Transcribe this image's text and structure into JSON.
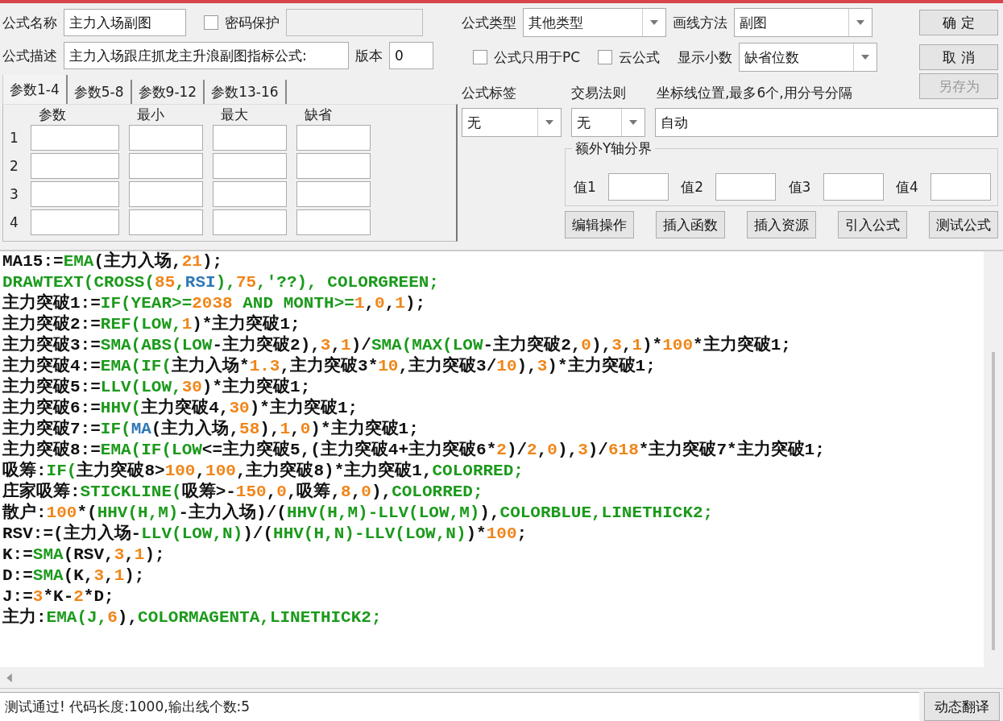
{
  "name": {
    "label": "公式名称",
    "value": "主力入场副图"
  },
  "password": {
    "label": "密码保护",
    "checked": false
  },
  "description": {
    "label": "公式描述",
    "value": "主力入场跟庄抓龙主升浪副图指标公式:"
  },
  "version": {
    "label": "版本",
    "value": "0"
  },
  "param_tabs": [
    {
      "label": "参数1-4",
      "selected": true
    },
    {
      "label": "参数5-8",
      "selected": false
    },
    {
      "label": "参数9-12",
      "selected": false
    },
    {
      "label": "参数13-16",
      "selected": false
    }
  ],
  "param_table": {
    "columns": [
      "参数",
      "最小",
      "最大",
      "缺省"
    ],
    "rows": [
      "1",
      "2",
      "3",
      "4"
    ]
  },
  "formula_type": {
    "label": "公式类型",
    "value": "其他类型"
  },
  "draw_method": {
    "label": "画线方法",
    "value": "副图"
  },
  "pc_only": {
    "label": "公式只用于PC",
    "checked": false
  },
  "cloud": {
    "label": "云公式",
    "checked": false
  },
  "decimals": {
    "label": "显示小数",
    "value": "缺省位数"
  },
  "side_buttons": [
    {
      "label": "确 定",
      "disabled": false
    },
    {
      "label": "取 消",
      "disabled": false
    },
    {
      "label": "另存为",
      "disabled": true
    }
  ],
  "formula_tag": {
    "label": "公式标签",
    "value": "无"
  },
  "trade_rule": {
    "label": "交易法则",
    "value": "无"
  },
  "axis_lines": {
    "label": "坐标线位置,最多6个,用分号分隔",
    "value": "自动"
  },
  "y_bounds": {
    "title": "额外Y轴分界",
    "labels": [
      "值1",
      "值2",
      "值3",
      "值4"
    ]
  },
  "tools": [
    "编辑操作",
    "插入函数",
    "插入资源",
    "引入公式",
    "测试公式"
  ],
  "code": [
    [
      {
        "kind": "text",
        "text": "MA15:="
      },
      {
        "kind": "fn",
        "text": "EMA"
      },
      {
        "kind": "text",
        "text": "(主力入场,"
      },
      {
        "kind": "num",
        "text": "21"
      },
      {
        "kind": "text",
        "text": ");"
      }
    ],
    [
      {
        "kind": "fn",
        "text": "DRAWTEXT(CROSS("
      },
      {
        "kind": "num",
        "text": "85"
      },
      {
        "kind": "fn",
        "text": ","
      },
      {
        "kind": "var",
        "text": "RSI"
      },
      {
        "kind": "fn",
        "text": "),"
      },
      {
        "kind": "num",
        "text": "75"
      },
      {
        "kind": "fn",
        "text": ",'??), COLORGREEN;"
      }
    ],
    [
      {
        "kind": "text",
        "text": "主力突破1:="
      },
      {
        "kind": "fn",
        "text": "IF(YEAR>="
      },
      {
        "kind": "num",
        "text": "2038"
      },
      {
        "kind": "fn",
        "text": " AND MONTH>="
      },
      {
        "kind": "num",
        "text": "1"
      },
      {
        "kind": "text",
        "text": ","
      },
      {
        "kind": "num",
        "text": "0"
      },
      {
        "kind": "text",
        "text": ","
      },
      {
        "kind": "num",
        "text": "1"
      },
      {
        "kind": "text",
        "text": ");"
      }
    ],
    [
      {
        "kind": "text",
        "text": "主力突破2:="
      },
      {
        "kind": "fn",
        "text": "REF(LOW,"
      },
      {
        "kind": "num",
        "text": "1"
      },
      {
        "kind": "text",
        "text": ")*主力突破1;"
      }
    ],
    [
      {
        "kind": "text",
        "text": "主力突破3:="
      },
      {
        "kind": "fn",
        "text": "SMA(ABS(LOW"
      },
      {
        "kind": "text",
        "text": "-主力突破2),"
      },
      {
        "kind": "num",
        "text": "3"
      },
      {
        "kind": "text",
        "text": ","
      },
      {
        "kind": "num",
        "text": "1"
      },
      {
        "kind": "text",
        "text": ")/"
      },
      {
        "kind": "fn",
        "text": "SMA(MAX(LOW"
      },
      {
        "kind": "text",
        "text": "-主力突破2,"
      },
      {
        "kind": "num",
        "text": "0"
      },
      {
        "kind": "text",
        "text": "),"
      },
      {
        "kind": "num",
        "text": "3"
      },
      {
        "kind": "text",
        "text": ","
      },
      {
        "kind": "num",
        "text": "1"
      },
      {
        "kind": "text",
        "text": ")*"
      },
      {
        "kind": "num",
        "text": "100"
      },
      {
        "kind": "text",
        "text": "*主力突破1;"
      }
    ],
    [
      {
        "kind": "text",
        "text": "主力突破4:="
      },
      {
        "kind": "fn",
        "text": "EMA(IF("
      },
      {
        "kind": "text",
        "text": "主力入场*"
      },
      {
        "kind": "num",
        "text": "1.3"
      },
      {
        "kind": "text",
        "text": ",主力突破3*"
      },
      {
        "kind": "num",
        "text": "10"
      },
      {
        "kind": "text",
        "text": ",主力突破3/"
      },
      {
        "kind": "num",
        "text": "10"
      },
      {
        "kind": "text",
        "text": "),"
      },
      {
        "kind": "num",
        "text": "3"
      },
      {
        "kind": "text",
        "text": ")*主力突破1;"
      }
    ],
    [
      {
        "kind": "text",
        "text": "主力突破5:="
      },
      {
        "kind": "fn",
        "text": "LLV(LOW,"
      },
      {
        "kind": "num",
        "text": "30"
      },
      {
        "kind": "text",
        "text": ")*主力突破1;"
      }
    ],
    [
      {
        "kind": "text",
        "text": "主力突破6:="
      },
      {
        "kind": "fn",
        "text": "HHV("
      },
      {
        "kind": "text",
        "text": "主力突破4,"
      },
      {
        "kind": "num",
        "text": "30"
      },
      {
        "kind": "text",
        "text": ")*主力突破1;"
      }
    ],
    [
      {
        "kind": "text",
        "text": "主力突破7:="
      },
      {
        "kind": "fn",
        "text": "IF("
      },
      {
        "kind": "var",
        "text": "MA"
      },
      {
        "kind": "text",
        "text": "(主力入场,"
      },
      {
        "kind": "num",
        "text": "58"
      },
      {
        "kind": "text",
        "text": "),"
      },
      {
        "kind": "num",
        "text": "1"
      },
      {
        "kind": "text",
        "text": ","
      },
      {
        "kind": "num",
        "text": "0"
      },
      {
        "kind": "text",
        "text": ")*主力突破1;"
      }
    ],
    [
      {
        "kind": "text",
        "text": "主力突破8:="
      },
      {
        "kind": "fn",
        "text": "EMA(IF(LOW"
      },
      {
        "kind": "text",
        "text": "<=主力突破5,(主力突破4+主力突破6*"
      },
      {
        "kind": "num",
        "text": "2"
      },
      {
        "kind": "text",
        "text": ")/"
      },
      {
        "kind": "num",
        "text": "2"
      },
      {
        "kind": "text",
        "text": ","
      },
      {
        "kind": "num",
        "text": "0"
      },
      {
        "kind": "text",
        "text": "),"
      },
      {
        "kind": "num",
        "text": "3"
      },
      {
        "kind": "text",
        "text": ")/"
      },
      {
        "kind": "num",
        "text": "618"
      },
      {
        "kind": "text",
        "text": "*主力突破7*主力突破1;"
      }
    ],
    [
      {
        "kind": "text",
        "text": "吸筹:"
      },
      {
        "kind": "fn",
        "text": "IF("
      },
      {
        "kind": "text",
        "text": "主力突破8>"
      },
      {
        "kind": "num",
        "text": "100"
      },
      {
        "kind": "text",
        "text": ","
      },
      {
        "kind": "num",
        "text": "100"
      },
      {
        "kind": "text",
        "text": ",主力突破8)*主力突破1,"
      },
      {
        "kind": "fn",
        "text": "COLORRED;"
      }
    ],
    [
      {
        "kind": "text",
        "text": "庄家吸筹:"
      },
      {
        "kind": "fn",
        "text": "STICKLINE("
      },
      {
        "kind": "text",
        "text": "吸筹>-"
      },
      {
        "kind": "num",
        "text": "150"
      },
      {
        "kind": "text",
        "text": ","
      },
      {
        "kind": "num",
        "text": "0"
      },
      {
        "kind": "text",
        "text": ",吸筹,"
      },
      {
        "kind": "num",
        "text": "8"
      },
      {
        "kind": "text",
        "text": ","
      },
      {
        "kind": "num",
        "text": "0"
      },
      {
        "kind": "text",
        "text": "),"
      },
      {
        "kind": "fn",
        "text": "COLORRED;"
      }
    ],
    [
      {
        "kind": "text",
        "text": "散户:"
      },
      {
        "kind": "num",
        "text": "100"
      },
      {
        "kind": "text",
        "text": "*("
      },
      {
        "kind": "fn",
        "text": "HHV(H,M)"
      },
      {
        "kind": "text",
        "text": "-主力入场)/("
      },
      {
        "kind": "fn",
        "text": "HHV(H,M)-LLV(LOW,M)"
      },
      {
        "kind": "text",
        "text": "),"
      },
      {
        "kind": "fn",
        "text": "COLORBLUE,LINETHICK2;"
      }
    ],
    [
      {
        "kind": "text",
        "text": "RSV:=(主力入场-"
      },
      {
        "kind": "fn",
        "text": "LLV(LOW,N)"
      },
      {
        "kind": "text",
        "text": ")/("
      },
      {
        "kind": "fn",
        "text": "HHV(H,N)-LLV(LOW,N)"
      },
      {
        "kind": "text",
        "text": ")*"
      },
      {
        "kind": "num",
        "text": "100"
      },
      {
        "kind": "text",
        "text": ";"
      }
    ],
    [
      {
        "kind": "text",
        "text": "K:="
      },
      {
        "kind": "fn",
        "text": "SMA"
      },
      {
        "kind": "text",
        "text": "(RSV,"
      },
      {
        "kind": "num",
        "text": "3"
      },
      {
        "kind": "text",
        "text": ","
      },
      {
        "kind": "num",
        "text": "1"
      },
      {
        "kind": "text",
        "text": ");"
      }
    ],
    [
      {
        "kind": "text",
        "text": "D:="
      },
      {
        "kind": "fn",
        "text": "SMA"
      },
      {
        "kind": "text",
        "text": "(K,"
      },
      {
        "kind": "num",
        "text": "3"
      },
      {
        "kind": "text",
        "text": ","
      },
      {
        "kind": "num",
        "text": "1"
      },
      {
        "kind": "text",
        "text": ");"
      }
    ],
    [
      {
        "kind": "text",
        "text": "J:="
      },
      {
        "kind": "num",
        "text": "3"
      },
      {
        "kind": "text",
        "text": "*K-"
      },
      {
        "kind": "num",
        "text": "2"
      },
      {
        "kind": "text",
        "text": "*D;"
      }
    ],
    [
      {
        "kind": "text",
        "text": "主力:"
      },
      {
        "kind": "fn",
        "text": "EMA(J,"
      },
      {
        "kind": "num",
        "text": "6"
      },
      {
        "kind": "text",
        "text": "),"
      },
      {
        "kind": "fn",
        "text": "COLORMAGENTA,LINETHICK2;"
      }
    ]
  ],
  "status": "测试通过! 代码长度:1000,输出线个数:5",
  "translate_button": "动态翻译"
}
